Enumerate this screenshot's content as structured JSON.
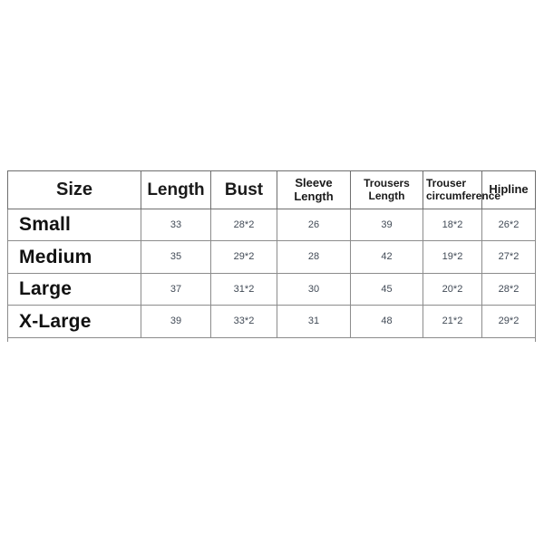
{
  "table": {
    "name": "size-chart",
    "columns": [
      {
        "key": "size",
        "label": "Size",
        "style": "size"
      },
      {
        "key": "length",
        "label": "Length",
        "style": "big"
      },
      {
        "key": "bust",
        "label": "Bust",
        "style": "big"
      },
      {
        "key": "sleeve_length",
        "label": "Sleeve Length",
        "style": "mid"
      },
      {
        "key": "trousers_length",
        "label": "Trousers Length",
        "style": "small"
      },
      {
        "key": "trouser_circumference",
        "label": "Trouser circumference",
        "style": "wrap2"
      },
      {
        "key": "hipline",
        "label": "Hipline",
        "style": "mid"
      }
    ],
    "rows": [
      {
        "size": "Small",
        "length": "33",
        "bust": "28*2",
        "sleeve_length": "26",
        "trousers_length": "39",
        "trouser_circumference": "18*2",
        "hipline": "26*2"
      },
      {
        "size": "Medium",
        "length": "35",
        "bust": "29*2",
        "sleeve_length": "28",
        "trousers_length": "42",
        "trouser_circumference": "19*2",
        "hipline": "27*2"
      },
      {
        "size": "Large",
        "length": "37",
        "bust": "31*2",
        "sleeve_length": "30",
        "trousers_length": "45",
        "trouser_circumference": "20*2",
        "hipline": "28*2"
      },
      {
        "size": "X-Large",
        "length": "39",
        "bust": "33*2",
        "sleeve_length": "31",
        "trousers_length": "48",
        "trouser_circumference": "21*2",
        "hipline": "29*2"
      }
    ]
  },
  "colors": {
    "background": "#ffffff",
    "border": "#8c8c8c",
    "header_text": "#1a1a1a",
    "size_text": "#111111",
    "value_text": "#414a56"
  }
}
